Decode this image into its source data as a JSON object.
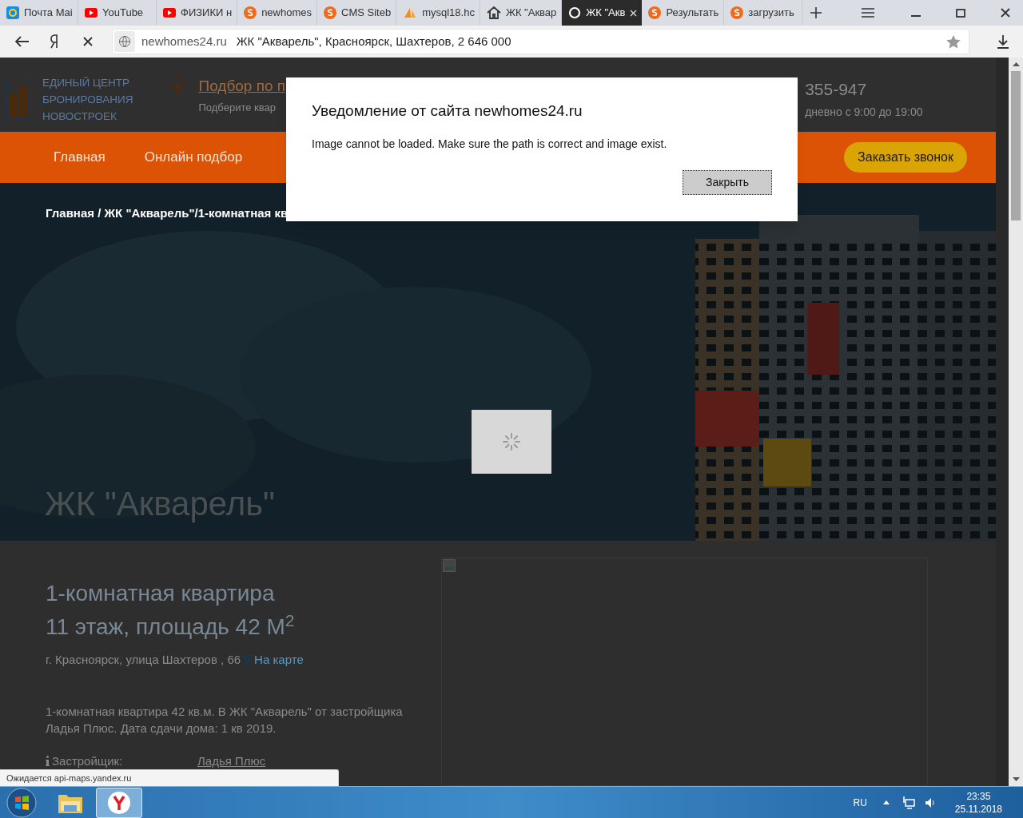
{
  "browser": {
    "tabs": [
      {
        "title": "Почта Mai",
        "kind": "mail",
        "selected": false
      },
      {
        "title": "YouTube",
        "kind": "youtube",
        "selected": false
      },
      {
        "title": "ФИЗИКИ н",
        "kind": "youtube",
        "selected": false
      },
      {
        "title": "newhomes",
        "kind": "s",
        "selected": false
      },
      {
        "title": "CMS Siteb",
        "kind": "s",
        "selected": false
      },
      {
        "title": "mysql18.hc",
        "kind": "pma",
        "selected": false
      },
      {
        "title": "ЖК \"Аквар",
        "kind": "home",
        "selected": false
      },
      {
        "title": "ЖК \"Акв",
        "kind": "loading",
        "selected": true
      },
      {
        "title": "Результать",
        "kind": "s",
        "selected": false
      },
      {
        "title": "загрузить",
        "kind": "s",
        "selected": false
      }
    ],
    "address_bar": {
      "domain": "newhomes24.ru",
      "page_title": "ЖК \"Акварель\", Красноярск, Шахтеров, 2 646 000"
    },
    "status_text": "Ожидается api-maps.yandex.ru"
  },
  "site": {
    "logo_lines": [
      "ЕДИНЫЙ ЦЕНТР",
      "БРОНИРОВАНИЯ",
      "НОВОСТРОЕК"
    ],
    "header_link": "Подбор по п",
    "header_hint": "Подберите квар",
    "phone": "355-947",
    "hours": "дневно с 9:00 до 19:00",
    "nav": [
      "Главная",
      "Онлайн подбор"
    ],
    "callback_button": "Заказать звонок",
    "breadcrumb": "Главная / ЖК \"Акварель\"/1-комнатная кв",
    "hero_title": "ЖК \"Акварель\"",
    "apartment": {
      "title": "1-комнатная квартира",
      "subtitle": "11 этаж, площадь 42 М$^{2}$",
      "address": "г. Красноярск, улица Шахтеров , 66",
      "map_link": "На карте",
      "description": "1-комнатная квартира 42 кв.м. В ЖК \"Акварель\" от застройщика Ладья Плюс. Дата сдачи дома: 1 кв 2019.",
      "developer_label": "Застройщик:",
      "developer_value": "Ладья Плюс"
    }
  },
  "dialog": {
    "title": "Уведомление от сайта newhomes24.ru",
    "message": "Image cannot be loaded. Make sure the path is correct and image exist.",
    "button": "Закрыть"
  },
  "taskbar": {
    "language": "RU",
    "time": "23:35",
    "date": "25.11.2018"
  }
}
